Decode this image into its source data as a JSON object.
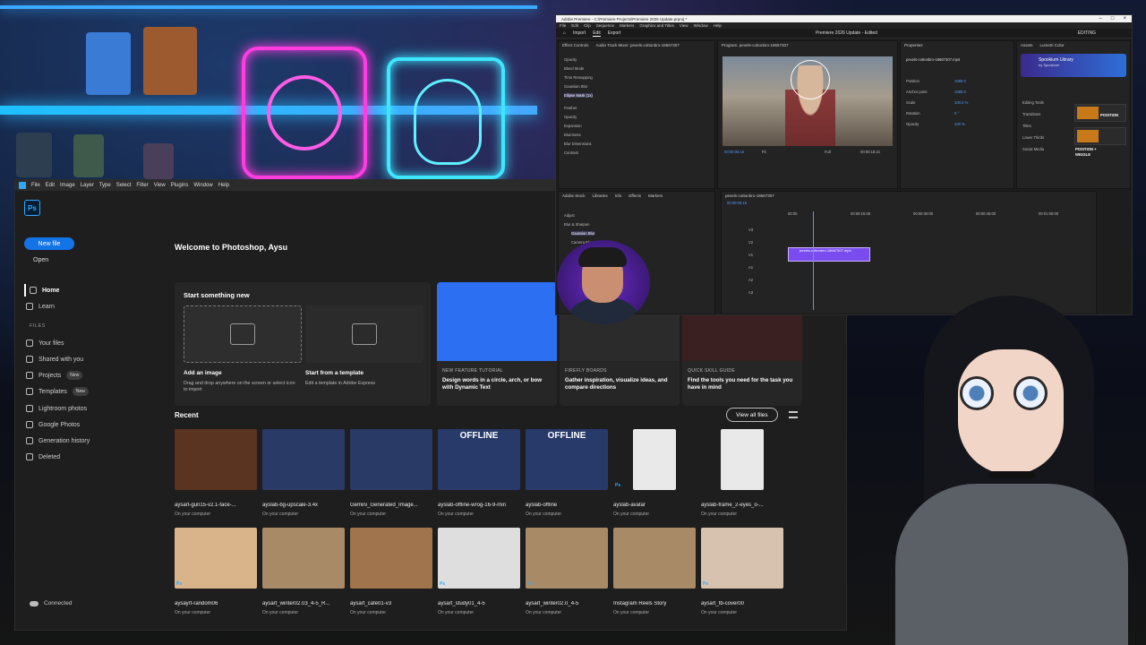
{
  "photoshop": {
    "menu": [
      "File",
      "Edit",
      "Image",
      "Layer",
      "Type",
      "Select",
      "Filter",
      "View",
      "Plugins",
      "Window",
      "Help"
    ],
    "logo": "Ps",
    "new_file": "New file",
    "open": "Open",
    "nav": [
      {
        "label": "Home",
        "icon": "home-icon"
      },
      {
        "label": "Learn",
        "icon": "lightbulb-icon"
      }
    ],
    "files_section": "FILES",
    "files": [
      {
        "label": "Your files",
        "icon": "folder-icon"
      },
      {
        "label": "Shared with you",
        "icon": "people-icon"
      },
      {
        "label": "Projects",
        "icon": "projects-icon",
        "badge": "New"
      },
      {
        "label": "Templates",
        "icon": "template-icon",
        "badge": "New"
      },
      {
        "label": "Lightroom photos",
        "icon": "lightroom-icon"
      },
      {
        "label": "Google Photos",
        "icon": "google-icon"
      },
      {
        "label": "Generation history",
        "icon": "history-icon"
      },
      {
        "label": "Deleted",
        "icon": "trash-icon"
      }
    ],
    "connected": "Connected",
    "welcome": "Welcome to Photoshop, Aysu",
    "start_header": "Start something new",
    "add_image": {
      "title": "Add an image",
      "desc": "Drag and drop anywhere on the screen or select icon to import"
    },
    "template": {
      "title": "Start from a template",
      "desc": "Edit a template in Adobe Express"
    },
    "promos": [
      {
        "kicker": "NEW FEATURE TUTORIAL",
        "title": "Design words in a circle, arch, or bow with Dynamic Text",
        "color": "#2d6ff2"
      },
      {
        "kicker": "FIREFLY BOARDS",
        "title": "Gather inspiration, visualize ideas, and compare directions",
        "color": "#2b2b2b"
      },
      {
        "kicker": "QUICK SKILL GUIDE",
        "title": "Find the tools you need for the task you have in mind",
        "color": "#3a2020"
      }
    ],
    "recent_title": "Recent",
    "view_all": "View all files",
    "recent_row1": [
      {
        "name": "aysart-gun15-v2.1-face-...",
        "loc": "On your computer",
        "color": "#5a3420"
      },
      {
        "name": "ayslab-bg-upscale-3.4x",
        "loc": "On your computer",
        "color": "#2a3a66"
      },
      {
        "name": "Gemini_Generated_Image...",
        "loc": "On your computer",
        "color": "#2a3a66"
      },
      {
        "name": "ayslab-offline-wrog-16-9-min",
        "loc": "On your computer",
        "color": "#273a6a",
        "overlay": "OFFLINE"
      },
      {
        "name": "ayslab-offline",
        "loc": "On your computer",
        "color": "#273a6a",
        "overlay": "OFFLINE"
      },
      {
        "name": "ayslab-avatar",
        "loc": "On your computer",
        "color": "#e9e9e9",
        "kind": "Ps"
      },
      {
        "name": "ayslab-frame_2-eyes_o-...",
        "loc": "On your computer",
        "color": "#e9e9e9"
      }
    ],
    "recent_row2": [
      {
        "name": "aysayrt-random06",
        "loc": "On your computer",
        "color": "#d9b48a",
        "kind": "Ps"
      },
      {
        "name": "aysart_winter02.03_4-5_R...",
        "loc": "On your computer",
        "color": "#a88a66"
      },
      {
        "name": "aysart_cafe01-v3",
        "loc": "On your computer",
        "color": "#a0744c"
      },
      {
        "name": "aysart_study01_4-5",
        "loc": "On your computer",
        "color": "#dedede",
        "kind": "Ps"
      },
      {
        "name": "aysart_winter02.0_4-5",
        "loc": "On your computer",
        "color": "#a88a66",
        "kind": "Ps"
      },
      {
        "name": "Instagram Reels Story",
        "loc": "On your computer",
        "color": "#a88a66"
      },
      {
        "name": "aysart_fb-cover00",
        "loc": "On your computer",
        "color": "#d7c2b0",
        "kind": "Ps"
      }
    ]
  },
  "premiere": {
    "title": "Adobe Premiere - C:\\Premiere Projects\\Premiere 2026 Update.prproj *",
    "menu": [
      "File",
      "Edit",
      "Clip",
      "Sequence",
      "Markers",
      "Graphics and Titles",
      "View",
      "Window",
      "Help"
    ],
    "workspace": [
      "Import",
      "Edit",
      "Export"
    ],
    "project_name": "Premiere 2026 Update - Edited",
    "editing": "EDITING",
    "effect_tabs": [
      "Effect Controls",
      "Audio Track Mixer: pexels-cottonbro-18667307"
    ],
    "effect_rows": [
      "Opacity",
      "Blend Mode",
      "Time Remapping",
      "Gaussian Blur",
      "Ellipse Mask (1x)",
      "Feather",
      "Opacity",
      "Expansion",
      "Blurriness",
      "Blur Dimensions",
      "Contrast"
    ],
    "program_label": "Program: pexels-cottonbro-18667307",
    "timecode_left": "00:00:05:16",
    "timecode_right": "00:00:18:21",
    "fit": "Fit",
    "full": "Full",
    "properties_tab": "Properties",
    "clip_name": "pexels-cottonbro-18667307.mp4",
    "properties": [
      {
        "label": "Position",
        "value": "1080.0"
      },
      {
        "label": "Anchor point",
        "value": "1080.0"
      },
      {
        "label": "Scale",
        "value": "100.0 %"
      },
      {
        "label": "Rotation",
        "value": "0 °"
      },
      {
        "label": "Opacity",
        "value": "100 %"
      }
    ],
    "essential_tabs": [
      "Assets",
      "Lumetri Color"
    ],
    "library_name": "Spookium Library",
    "library_by": "by Spookium",
    "essential_items": [
      "Editing Tools",
      "Transitions",
      "Titles",
      "Lower Thirds",
      "Social Media"
    ],
    "essential_cards": [
      "POSITION",
      "POSITION + WIGGLE"
    ],
    "bottom_tabs": [
      "Adobe Stock",
      "Libraries",
      "Info",
      "Effects",
      "Markers"
    ],
    "effects_tree": [
      "Adjust",
      "Blur & Sharpen",
      "Gaussian Blur",
      "Camera Blur"
    ],
    "sequence_name": "pexels-cottonbro-18667307",
    "seq_timecode": "00:00:05:16",
    "ruler": [
      "00:00",
      "00:00:15:00",
      "00:00:30:00",
      "00:00:45:00",
      "00:01:00:00"
    ],
    "tracks": [
      "V3",
      "V2",
      "V1",
      "A1",
      "A2",
      "A3"
    ],
    "clip_label": "pexels-cottonbro-18667307.mp4"
  },
  "colors": {
    "accent": "#1473e6",
    "ps_blue": "#31a8ff",
    "clip": "#7a4cf0"
  }
}
